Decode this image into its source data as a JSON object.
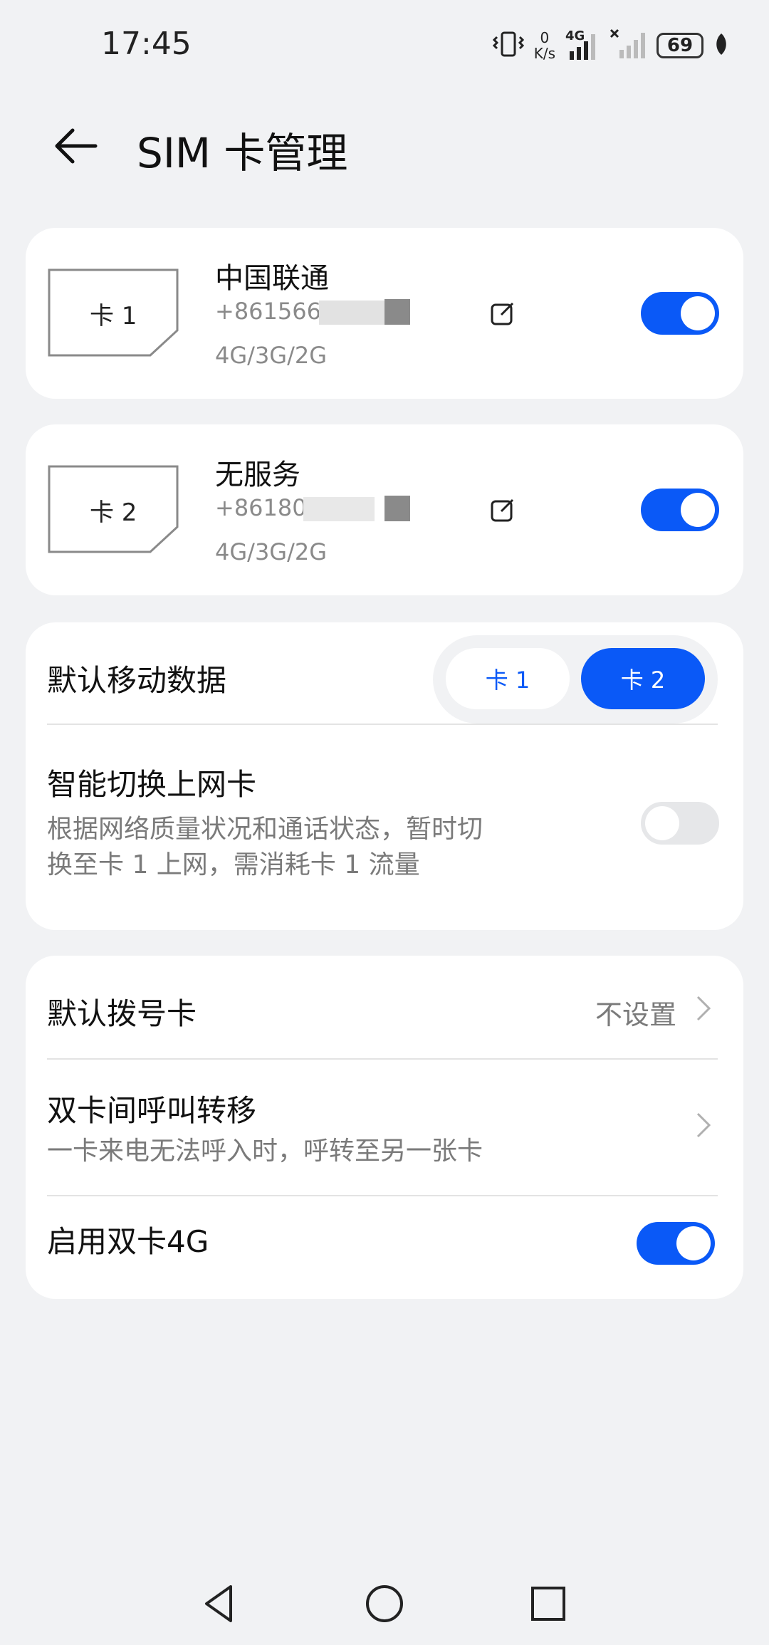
{
  "status_bar": {
    "time": "17:45",
    "net_speed_value": "0",
    "net_speed_unit": "K/s",
    "network_type": "4G",
    "battery": "69",
    "icons": [
      "vibrate-icon",
      "signal-4g-icon",
      "signal-no-service-icon",
      "battery-icon",
      "leaf-icon"
    ]
  },
  "header": {
    "title": "SIM 卡管理"
  },
  "sim_cards": [
    {
      "slot_label": "卡 1",
      "carrier": "中国联通",
      "phone": "+8615666",
      "network": "4G/3G/2G",
      "enabled": true
    },
    {
      "slot_label": "卡 2",
      "carrier": "无服务",
      "phone": "+861809",
      "network": "4G/3G/2G",
      "enabled": true
    }
  ],
  "default_data": {
    "label": "默认移动数据",
    "options": [
      "卡 1",
      "卡 2"
    ],
    "selected": "卡 2"
  },
  "smart_switch": {
    "title": "智能切换上网卡",
    "desc_line1": "根据网络质量状况和通话状态，暂时切",
    "desc_line2": "换至卡 1 上网，需消耗卡 1 流量",
    "enabled": false
  },
  "default_dial": {
    "label": "默认拨号卡",
    "value": "不设置"
  },
  "call_forward": {
    "title": "双卡间呼叫转移",
    "desc": "一卡来电无法呼入时，呼转至另一张卡"
  },
  "dual_4g": {
    "label": "启用双卡4G",
    "enabled": true
  },
  "colors": {
    "accent": "#0a59f7",
    "background": "#f1f2f4",
    "card": "#ffffff",
    "secondary_text": "#7a7a7a"
  }
}
